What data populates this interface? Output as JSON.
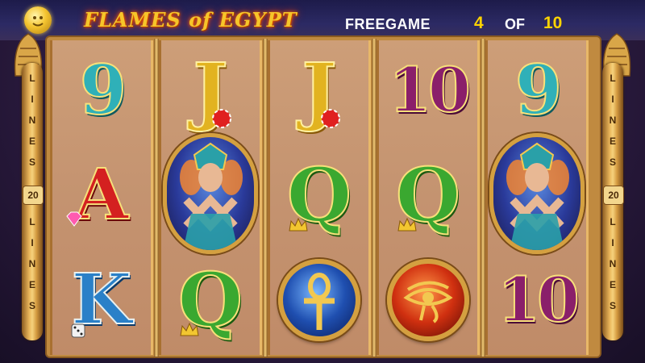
{
  "header": {
    "title": "FLAMES of EGYPT",
    "freegame_label": "FREEGAME",
    "freegame_current": "4",
    "freegame_of": "OF",
    "freegame_total": "10"
  },
  "pillars": {
    "top_text": [
      "L",
      "I",
      "N",
      "E",
      "S"
    ],
    "lines_count": "20",
    "bottom_text": [
      "L",
      "I",
      "N",
      "E",
      "S"
    ]
  },
  "reels": [
    [
      "9",
      "A",
      "K"
    ],
    [
      "J",
      "queen",
      "Q"
    ],
    [
      "J",
      "Q",
      "ankh"
    ],
    [
      "10",
      "Q",
      "eye"
    ],
    [
      "9",
      "queen",
      "10"
    ]
  ],
  "labels": {
    "r0s0": "9",
    "r0s1": "A",
    "r0s2": "K",
    "r1s0": "J",
    "r1s2": "Q",
    "r2s0": "J",
    "r2s1": "Q",
    "r3s0": "10",
    "r3s1": "Q",
    "r4s0": "9",
    "r4s2": "10"
  },
  "colors": {
    "title": "#f6c52a",
    "freegame_numbers": "#ffd400",
    "reel_background": "#c49370",
    "frame_gold": "#d4a040"
  },
  "icons": {
    "logo": "sun-face-icon",
    "ankh": "ankh-icon",
    "eye": "eye-of-horus-icon",
    "queen": "queen-scatter-icon"
  }
}
